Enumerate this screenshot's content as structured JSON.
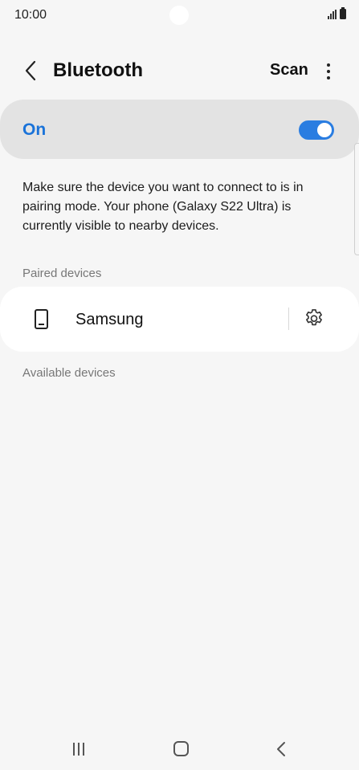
{
  "status_bar": {
    "time": "10:00"
  },
  "app_bar": {
    "title": "Bluetooth",
    "scan_label": "Scan"
  },
  "master_switch": {
    "label": "On",
    "enabled": true
  },
  "description": "Make sure the device you want to connect to is in pairing mode. Your phone (Galaxy S22 Ultra) is currently visible to nearby devices.",
  "paired_section": {
    "header": "Paired devices",
    "devices": [
      {
        "name": "Samsung",
        "icon": "phone-icon"
      }
    ]
  },
  "available_section": {
    "header": "Available devices"
  },
  "colors": {
    "accent": "#1a73d9",
    "switch_on": "#2a7de1",
    "background": "#f6f6f6"
  }
}
